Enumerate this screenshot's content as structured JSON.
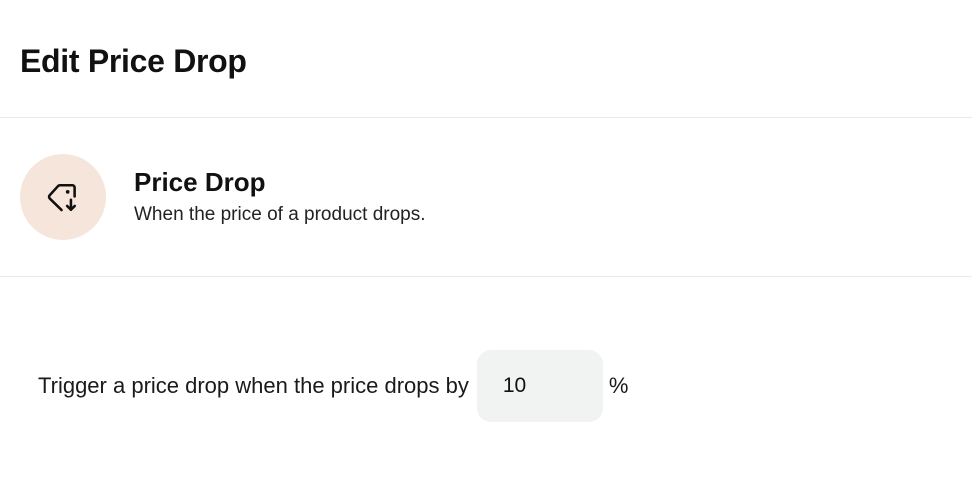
{
  "header": {
    "title": "Edit Price Drop"
  },
  "trigger": {
    "icon": "tag-down-arrow-icon",
    "icon_bg_color": "#f6e5da",
    "title": "Price Drop",
    "description": "When the price of a product drops."
  },
  "setting": {
    "label": "Trigger a price drop when the price drops by",
    "value": "10",
    "unit": "%"
  }
}
